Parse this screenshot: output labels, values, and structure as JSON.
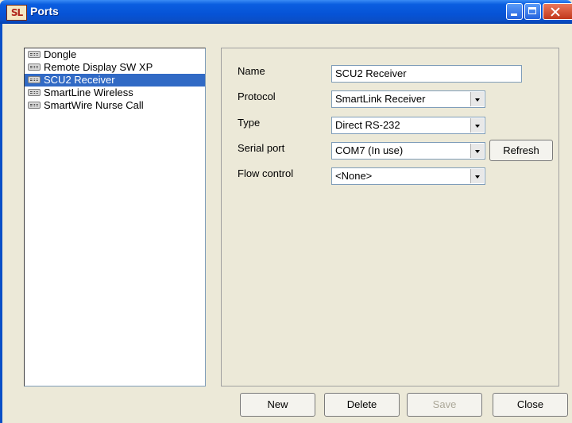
{
  "window": {
    "title": "Ports",
    "icon_text": "SL",
    "controls": [
      "minimize-icon",
      "maximize-icon",
      "close-icon"
    ]
  },
  "ports": [
    {
      "label": "Dongle",
      "selected": false
    },
    {
      "label": "Remote Display SW XP",
      "selected": false
    },
    {
      "label": "SCU2 Receiver",
      "selected": true
    },
    {
      "label": "SmartLine Wireless",
      "selected": false
    },
    {
      "label": "SmartWire Nurse Call",
      "selected": false
    }
  ],
  "form": {
    "name_label": "Name",
    "name_value": "SCU2 Receiver",
    "protocol_label": "Protocol",
    "protocol_value": "SmartLink Receiver",
    "type_label": "Type",
    "type_value": "Direct RS-232",
    "serial_label": "Serial port",
    "serial_value": "COM7 (In use)",
    "refresh_label": "Refresh",
    "flow_label": "Flow control",
    "flow_value": "<None>"
  },
  "buttons": {
    "new": "New",
    "delete": "Delete",
    "save": "Save",
    "close": "Close"
  },
  "colors": {
    "title_bar": "#0653d6",
    "selection": "#316ac5",
    "window_bg": "#ece9d8"
  }
}
